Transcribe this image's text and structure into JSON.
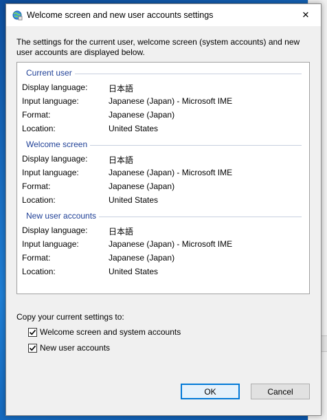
{
  "window": {
    "title": "Welcome screen and new user accounts settings",
    "close_glyph": "✕",
    "icon": "globe-settings-icon"
  },
  "intro_text": "The settings for the current user, welcome screen (system accounts) and new user accounts are displayed below.",
  "groups": [
    {
      "title": "Current user",
      "rows": [
        {
          "label": "Display language:",
          "value": "日本語"
        },
        {
          "label": "Input language:",
          "value": "Japanese (Japan) - Microsoft IME"
        },
        {
          "label": "Format:",
          "value": "Japanese (Japan)"
        },
        {
          "label": "Location:",
          "value": "United States"
        }
      ]
    },
    {
      "title": "Welcome screen",
      "rows": [
        {
          "label": "Display language:",
          "value": "日本語"
        },
        {
          "label": "Input language:",
          "value": "Japanese (Japan) - Microsoft IME"
        },
        {
          "label": "Format:",
          "value": "Japanese (Japan)"
        },
        {
          "label": "Location:",
          "value": "United States"
        }
      ]
    },
    {
      "title": "New user accounts",
      "rows": [
        {
          "label": "Display language:",
          "value": "日本語"
        },
        {
          "label": "Input language:",
          "value": "Japanese (Japan) - Microsoft IME"
        },
        {
          "label": "Format:",
          "value": "Japanese (Japan)"
        },
        {
          "label": "Location:",
          "value": "United States"
        }
      ]
    }
  ],
  "copy": {
    "label": "Copy your current settings to:",
    "welcome_label": "Welcome screen and system accounts",
    "welcome_checked": true,
    "new_users_label": "New user accounts",
    "new_users_checked": true
  },
  "buttons": {
    "ok": "OK",
    "cancel": "Cancel"
  },
  "colors": {
    "group_title": "#1e3f96",
    "accent": "#0078d7"
  }
}
